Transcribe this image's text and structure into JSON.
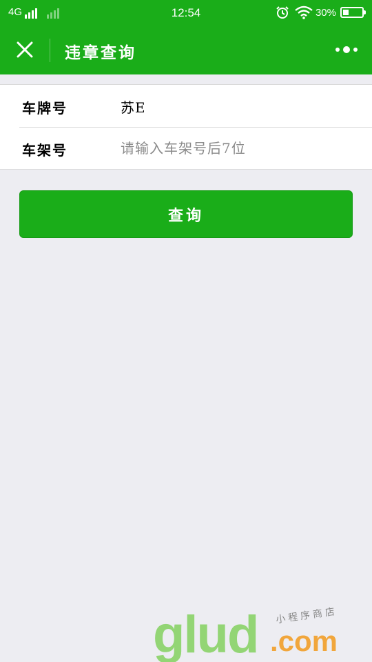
{
  "status_bar": {
    "network": "4G",
    "time": "12:54",
    "battery_percent": "30%",
    "battery_level": 0.3,
    "icons": [
      "signal-icon",
      "signal-weak-icon",
      "alarm-icon",
      "wifi-icon",
      "battery-icon"
    ]
  },
  "nav": {
    "title": "违章查询",
    "icons": [
      "close-icon",
      "more-icon"
    ]
  },
  "form": {
    "plate_label": "车牌号",
    "plate_value": "苏E",
    "frame_label": "车架号",
    "frame_placeholder": "请输入车架号后7位",
    "frame_value": ""
  },
  "button": {
    "query_label": "查询"
  },
  "watermark": {
    "logo": "glud",
    "domain": ".com",
    "subtitle": "小程序商店"
  },
  "colors": {
    "brand_green": "#1aad19",
    "background": "#ededf2",
    "placeholder": "#8a8a8a"
  }
}
